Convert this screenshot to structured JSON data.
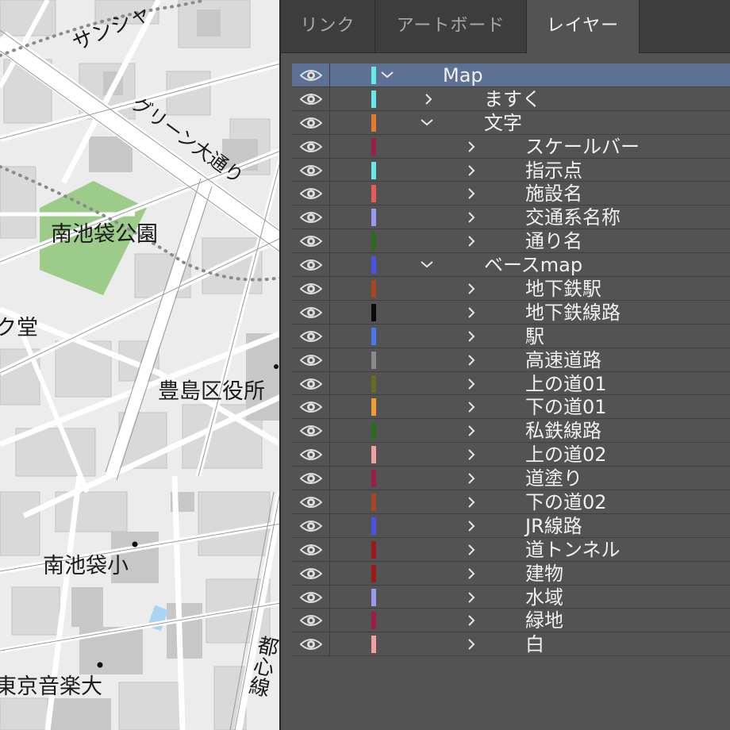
{
  "map": {
    "labels": {
      "sunshine": "サンシャ",
      "green_street": "グリーン大通り",
      "park": "南池袋公園",
      "do": "ク堂",
      "ward_office": "豊島区役所",
      "school": "南池袋小",
      "college": "東京音楽大",
      "toden": "都心線"
    },
    "colors": {
      "background": "#ececec",
      "block": "#d6d6d6",
      "road": "#ffffff",
      "park": "#9ccb8a",
      "water": "#a9d5f2"
    }
  },
  "panel": {
    "tabs": [
      {
        "label": "リンク",
        "active": false
      },
      {
        "label": "アートボード",
        "active": false
      },
      {
        "label": "レイヤー",
        "active": true
      }
    ],
    "layers": [
      {
        "name": "Map",
        "color": "#6ae8e8",
        "depth": 0,
        "expanded": true,
        "selected": true
      },
      {
        "name": "ますく",
        "color": "#6ae8e8",
        "depth": 1,
        "expanded": false
      },
      {
        "name": "文字",
        "color": "#e57a2c",
        "depth": 1,
        "expanded": true
      },
      {
        "name": "スケールバー",
        "color": "#9c1f45",
        "depth": 2,
        "expanded": false
      },
      {
        "name": "指示点",
        "color": "#6ae8e8",
        "depth": 2,
        "expanded": false
      },
      {
        "name": "施設名",
        "color": "#e85a5a",
        "depth": 2,
        "expanded": false
      },
      {
        "name": "交通系名称",
        "color": "#9a9aee",
        "depth": 2,
        "expanded": false
      },
      {
        "name": "通り名",
        "color": "#2c6b1f",
        "depth": 2,
        "expanded": false
      },
      {
        "name": "ベースmap",
        "color": "#4a52e8",
        "depth": 1,
        "expanded": true
      },
      {
        "name": "地下鉄駅",
        "color": "#a8461f",
        "depth": 2,
        "expanded": false
      },
      {
        "name": "地下鉄線路",
        "color": "#0a0a0a",
        "depth": 2,
        "expanded": false
      },
      {
        "name": "駅",
        "color": "#4a78f0",
        "depth": 2,
        "expanded": false
      },
      {
        "name": "高速道路",
        "color": "#8a8a8a",
        "depth": 2,
        "expanded": false
      },
      {
        "name": "上の道01",
        "color": "#6b6b1f",
        "depth": 2,
        "expanded": false
      },
      {
        "name": "下の道01",
        "color": "#f0a030",
        "depth": 2,
        "expanded": false
      },
      {
        "name": "私鉄線路",
        "color": "#2c6b1f",
        "depth": 2,
        "expanded": false
      },
      {
        "name": "上の道02",
        "color": "#f0a0a0",
        "depth": 2,
        "expanded": false
      },
      {
        "name": "道塗り",
        "color": "#9c1f45",
        "depth": 2,
        "expanded": false
      },
      {
        "name": "下の道02",
        "color": "#a8461f",
        "depth": 2,
        "expanded": false
      },
      {
        "name": "JR線路",
        "color": "#4a52e8",
        "depth": 2,
        "expanded": false
      },
      {
        "name": "道トンネル",
        "color": "#9c1a1a",
        "depth": 2,
        "expanded": false
      },
      {
        "name": "建物",
        "color": "#9c1a1a",
        "depth": 2,
        "expanded": false
      },
      {
        "name": "水域",
        "color": "#9a9aee",
        "depth": 2,
        "expanded": false
      },
      {
        "name": "緑地",
        "color": "#9c1f45",
        "depth": 2,
        "expanded": false
      },
      {
        "name": "白",
        "color": "#f0a0a0",
        "depth": 2,
        "expanded": false
      }
    ]
  }
}
